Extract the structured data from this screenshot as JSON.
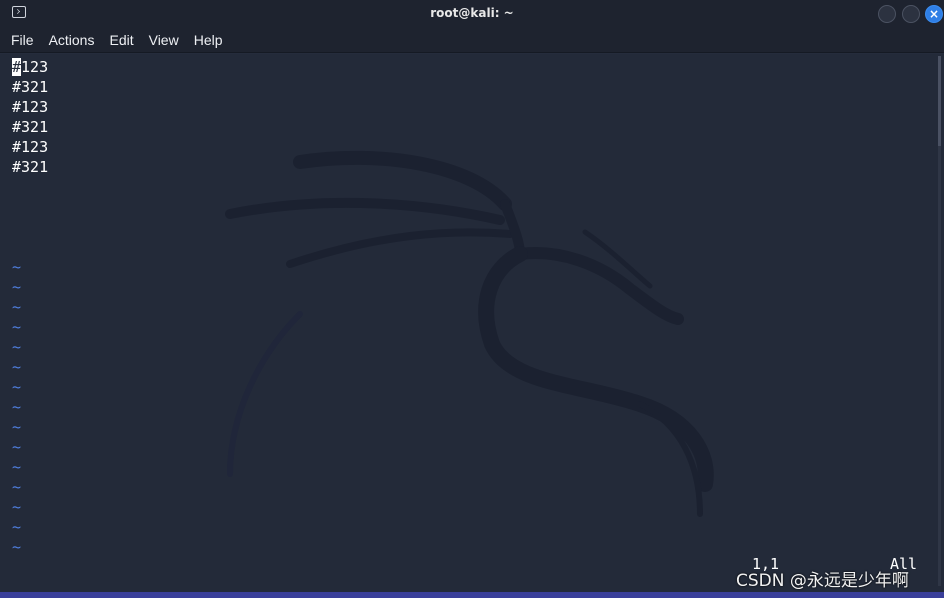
{
  "window": {
    "title": "root@kali: ~",
    "icon": "terminal-icon",
    "buttons": {
      "minimize": "minimize-icon",
      "maximize": "maximize-icon",
      "close": "close-icon",
      "close_glyph": "×"
    },
    "accent_color": "#2f7fe6"
  },
  "menu": {
    "items": [
      "File",
      "Actions",
      "Edit",
      "View",
      "Help"
    ]
  },
  "editor": {
    "lines": [
      "#123",
      "#321",
      "#123",
      "#321",
      "#123",
      "#321"
    ],
    "tilde": "~",
    "tilde_count": 15,
    "tilde_color": "#4f7fe0",
    "cursor_char": "#",
    "status_position": "1,1",
    "status_scroll": "All"
  },
  "watermark": "CSDN @永远是少年啊"
}
